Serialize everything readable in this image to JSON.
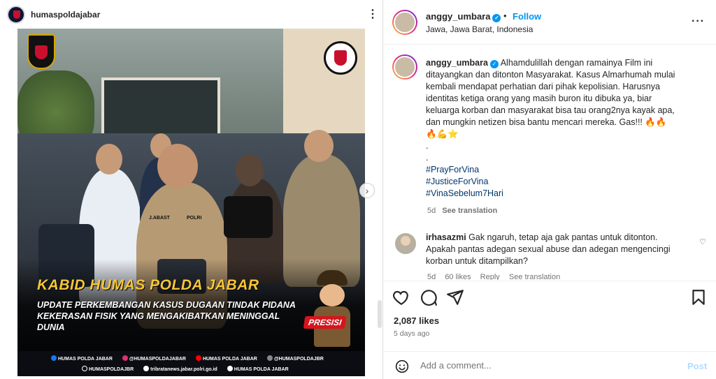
{
  "left_post": {
    "username": "humaspoldajabar",
    "photo": {
      "logo_left_text": "JAWA BARAT",
      "headline": "KABID HUMAS POLDA JABAR",
      "subheadline": "UPDATE PERKEMBANGAN KASUS DUGAAN TINDAK PIDANA KEKERASAN FISIK YANG MENGAKIBATKAN MENINGGAL DUNIA",
      "badge": "PRESISI",
      "name_tag": "J.ABAST",
      "polri_tag": "POLRI",
      "footer_row1": [
        "HUMAS POLDA JABAR",
        "@HUMASPOLDAJABAR",
        "HUMAS POLDA JABAR",
        "@HUMASPOLDAJBR"
      ],
      "footer_row2": [
        "HUMASPOLDAJBR",
        "tribratanews.jabar.polri.go.id",
        "HUMAS POLDA JABAR"
      ]
    }
  },
  "right_panel": {
    "header": {
      "username": "anggy_umbara",
      "follow_label": "Follow",
      "location": "Jawa, Jawa Barat, Indonesia"
    },
    "caption": {
      "username": "anggy_umbara",
      "text": "Alhamdulillah dengan ramainya Film ini ditayangkan dan ditonton Masyarakat. Kasus Almarhumah mulai kembali mendapat perhatian dari pihak kepolisian. Harusnya identitas ketiga orang yang masih buron itu dibuka ya, biar keluarga korban dan masyarakat bisa tau orang2nya kayak apa, dan mungkin netizen bisa bantu mencari mereka. Gas!!! 🔥🔥",
      "emojis": "🔥💪⭐",
      "dots": [
        ".",
        "."
      ],
      "hashtags": [
        "#PrayForVina",
        "#JusticeForVina",
        "#VinaSebelum7Hari"
      ],
      "age": "5d",
      "see_translation": "See translation"
    },
    "comment": {
      "username": "irhasazmi",
      "text": "Gak ngaruh, tetap aja gak pantas untuk ditonton. Apakah pantas adegan sexual abuse dan adegan mengencingi korban untuk ditampilkan?",
      "age": "5d",
      "likes": "60 likes",
      "reply": "Reply",
      "see_translation": "See translation"
    },
    "likes_count": "2,087 likes",
    "time_ago": "5 days ago",
    "add_comment": {
      "placeholder": "Add a comment...",
      "post_label": "Post"
    }
  }
}
